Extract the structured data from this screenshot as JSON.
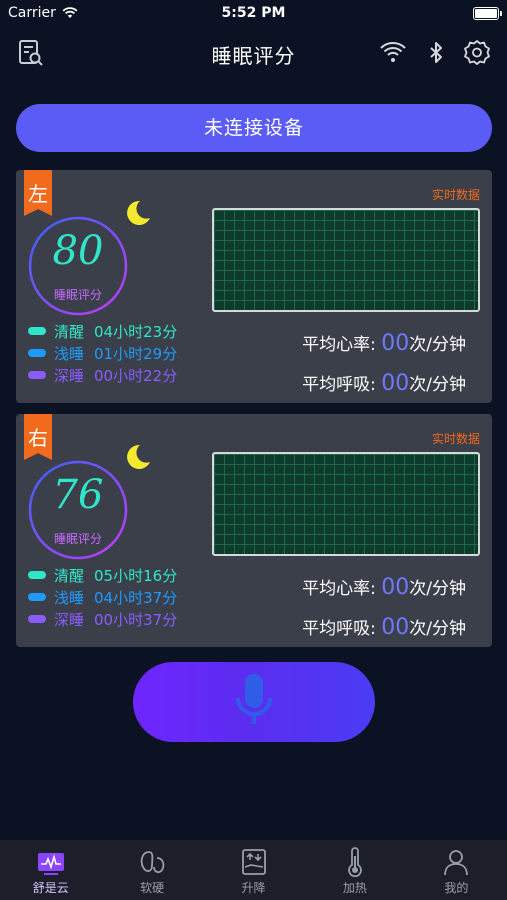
{
  "status_bar": {
    "carrier": "Carrier",
    "time": "5:52 PM"
  },
  "nav": {
    "title": "睡眠评分",
    "left_icon": "report-search-icon",
    "right_icons": [
      "wifi-icon",
      "bluetooth-icon",
      "gear-icon"
    ]
  },
  "connect_button": {
    "label": "未连接设备"
  },
  "beds": [
    {
      "side": "左",
      "score": "80",
      "score_label": "睡眠评分",
      "realtime_label": "实时数据",
      "stages": [
        {
          "label": "清醒",
          "value": "04小时23分",
          "color": "#2fe7c8"
        },
        {
          "label": "浅睡",
          "value": "01小时29分",
          "color": "#1e9bff"
        },
        {
          "label": "深睡",
          "value": "00小时22分",
          "color": "#8a5cff"
        }
      ],
      "heart_rate": {
        "label": "平均心率:",
        "value": "00",
        "unit": "次/分钟"
      },
      "breath_rate": {
        "label": "平均呼吸:",
        "value": "00",
        "unit": "次/分钟"
      }
    },
    {
      "side": "右",
      "score": "76",
      "score_label": "睡眠评分",
      "realtime_label": "实时数据",
      "stages": [
        {
          "label": "清醒",
          "value": "05小时16分",
          "color": "#2fe7c8"
        },
        {
          "label": "浅睡",
          "value": "04小时37分",
          "color": "#1e9bff"
        },
        {
          "label": "深睡",
          "value": "00小时37分",
          "color": "#8a5cff"
        }
      ],
      "heart_rate": {
        "label": "平均心率:",
        "value": "00",
        "unit": "次/分钟"
      },
      "breath_rate": {
        "label": "平均呼吸:",
        "value": "00",
        "unit": "次/分钟"
      }
    }
  ],
  "mic_button": {
    "icon": "microphone-icon"
  },
  "tabs": [
    {
      "label": "舒是云",
      "icon": "monitor-wave-icon",
      "active": true
    },
    {
      "label": "软硬",
      "icon": "firmness-icon",
      "active": false
    },
    {
      "label": "升降",
      "icon": "lift-icon",
      "active": false
    },
    {
      "label": "加热",
      "icon": "thermometer-icon",
      "active": false
    },
    {
      "label": "我的",
      "icon": "user-icon",
      "active": false
    }
  ],
  "colors": {
    "background": "#0b1224",
    "accent": "#5a5cf5",
    "panel": "#3b3f4a",
    "tag": "#f26a1b",
    "metric_value": "#6f78ff"
  }
}
